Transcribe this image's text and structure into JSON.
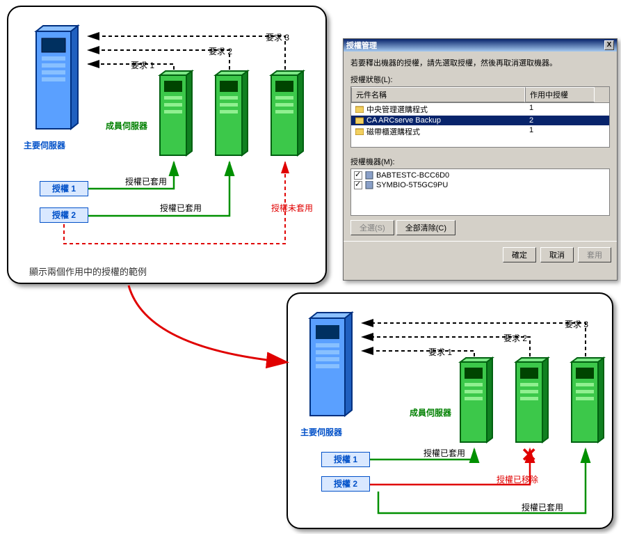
{
  "panel1": {
    "primary_server_label": "主要伺服器",
    "member_server_label": "成員伺服器",
    "license1": "授權 1",
    "license2": "授權 2",
    "req1": "要求 1",
    "req2": "要求 2",
    "req3": "要求 3",
    "applied1": "授權已套用",
    "applied2": "授權已套用",
    "not_applied": "授權未套用",
    "caption": "顯示兩個作用中的授權的範例"
  },
  "panel2": {
    "primary_server_label": "主要伺服器",
    "member_server_label": "成員伺服器",
    "license1": "授權 1",
    "license2": "授權 2",
    "req1": "要求 1",
    "req2": "要求 2",
    "req3": "要求 3",
    "applied1": "授權已套用",
    "removed": "授權已移除",
    "applied2": "授權已套用"
  },
  "dialog": {
    "title": "授權管理",
    "close": "X",
    "instruction": "若要釋出機器的授權，請先選取授權，然後再取消選取機器。",
    "status_label": "授權狀態(L):",
    "col_component": "元件名稱",
    "col_active": "作用中授權",
    "rows": [
      {
        "name": "中央管理選購程式",
        "count": "1"
      },
      {
        "name": "CA ARCserve Backup",
        "count": "2"
      },
      {
        "name": "磁帶櫃選購程式",
        "count": "1"
      }
    ],
    "machines_label": "授權機器(M):",
    "machines": [
      "BABTESTC-BCC6D0",
      "SYMBIO-5T5GC9PU"
    ],
    "btn_select_all": "全選(S)",
    "btn_clear_all": "全部清除(C)",
    "btn_ok": "確定",
    "btn_cancel": "取消",
    "btn_apply": "套用"
  }
}
